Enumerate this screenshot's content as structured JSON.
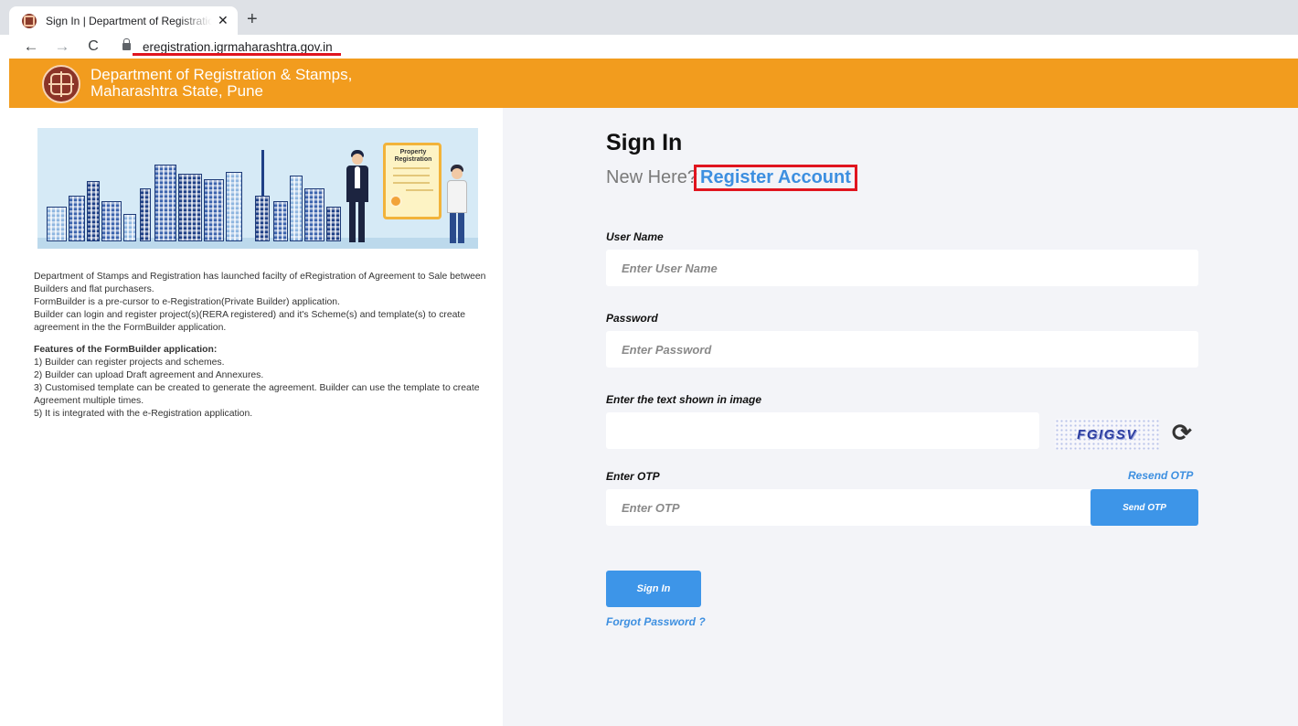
{
  "browser": {
    "tab_title": "Sign In | Department of Registration & Stamps",
    "tab_close": "✕",
    "new_tab": "+",
    "back": "←",
    "forward": "→",
    "reload": "C",
    "url": "eregistration.igrmaharashtra.gov.in"
  },
  "header": {
    "title_line1": "Department of Registration & Stamps,",
    "title_line2": "Maharashtra State, Pune"
  },
  "left": {
    "illustration": {
      "certificate_title": "Property Registration"
    },
    "intro_lines": [
      "Department of Stamps and Registration has launched facilty of eRegistration of Agreement to Sale between Builders and flat purchasers.",
      "FormBuilder is a pre-cursor to e-Registration(Private Builder) application.",
      "Builder can login and register project(s)(RERA registered) and it's Scheme(s) and template(s) to create agreement in the the FormBuilder application."
    ],
    "features_heading": "Features of the FormBuilder application:",
    "features": [
      "1) Builder can register projects and schemes.",
      "2) Builder can upload Draft agreement and Annexures.",
      "3) Customised template can be created to generate the agreement. Builder can use the template to create Agreement multiple times.",
      "5) It is integrated with the e-Registration application."
    ]
  },
  "form": {
    "title": "Sign In",
    "new_here": "New Here?",
    "register_link": "Register Account",
    "username_label": "User Name",
    "username_placeholder": "Enter User Name",
    "password_label": "Password",
    "password_placeholder": "Enter Password",
    "captcha_label": "Enter the text shown in image",
    "captcha_value": "",
    "captcha_text": "FGIGSV",
    "refresh_icon": "refresh-icon",
    "otp_label": "Enter OTP",
    "resend_otp": "Resend OTP",
    "otp_placeholder": "Enter OTP",
    "send_otp": "Send OTP",
    "signin_button": "Sign In",
    "forgot_password": "Forgot Password ?"
  },
  "colors": {
    "header_orange": "#f29c1e",
    "link_blue": "#3d8fe0",
    "button_blue": "#3d95e8",
    "highlight_red": "#e0151f",
    "form_background": "#f3f4f8"
  }
}
